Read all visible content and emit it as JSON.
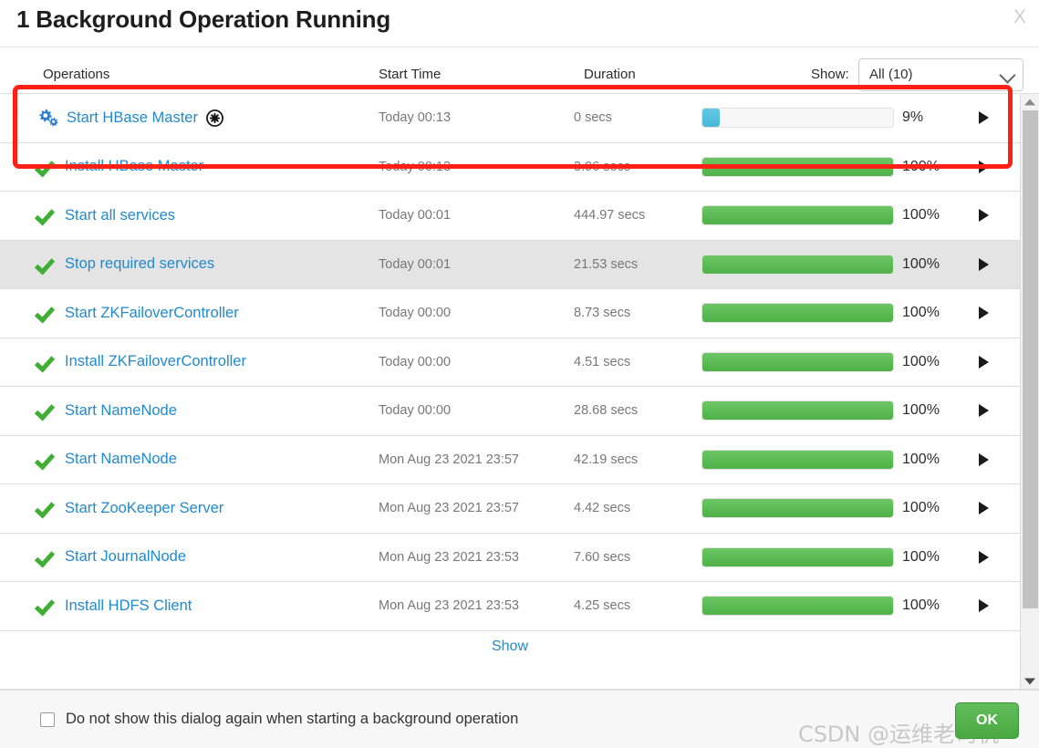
{
  "dialog": {
    "title": "1 Background Operation Running",
    "close_label": "X"
  },
  "columns": {
    "operations": "Operations",
    "start_time": "Start Time",
    "duration": "Duration",
    "show_label": "Show:",
    "show_selected": "All (10)",
    "show_options": [
      "All (10)"
    ]
  },
  "rows": [
    {
      "status_icon": "cogs-icon",
      "name": "Start HBase Master",
      "has_abort": true,
      "abort_icon": "abort-circle-icon",
      "start_time": "Today 00:13",
      "duration": "0 secs",
      "percent": 9,
      "percent_label": "9%",
      "state": "running",
      "highlight": false
    },
    {
      "status_icon": "check-icon",
      "name": "Install HBase Master",
      "has_abort": false,
      "start_time": "Today 00:13",
      "duration": "3.96 secs",
      "percent": 100,
      "percent_label": "100%",
      "state": "done",
      "highlight": false
    },
    {
      "status_icon": "check-icon",
      "name": "Start all services",
      "has_abort": false,
      "start_time": "Today 00:01",
      "duration": "444.97 secs",
      "percent": 100,
      "percent_label": "100%",
      "state": "done",
      "highlight": false
    },
    {
      "status_icon": "check-icon",
      "name": "Stop required services",
      "has_abort": false,
      "start_time": "Today 00:01",
      "duration": "21.53 secs",
      "percent": 100,
      "percent_label": "100%",
      "state": "done",
      "highlight": true
    },
    {
      "status_icon": "check-icon",
      "name": "Start ZKFailoverController",
      "has_abort": false,
      "start_time": "Today 00:00",
      "duration": "8.73 secs",
      "percent": 100,
      "percent_label": "100%",
      "state": "done",
      "highlight": false
    },
    {
      "status_icon": "check-icon",
      "name": "Install ZKFailoverController",
      "has_abort": false,
      "start_time": "Today 00:00",
      "duration": "4.51 secs",
      "percent": 100,
      "percent_label": "100%",
      "state": "done",
      "highlight": false
    },
    {
      "status_icon": "check-icon",
      "name": "Start NameNode",
      "has_abort": false,
      "start_time": "Today 00:00",
      "duration": "28.68 secs",
      "percent": 100,
      "percent_label": "100%",
      "state": "done",
      "highlight": false
    },
    {
      "status_icon": "check-icon",
      "name": "Start NameNode",
      "has_abort": false,
      "start_time": "Mon Aug 23 2021 23:57",
      "duration": "42.19 secs",
      "percent": 100,
      "percent_label": "100%",
      "state": "done",
      "highlight": false
    },
    {
      "status_icon": "check-icon",
      "name": "Start ZooKeeper Server",
      "has_abort": false,
      "start_time": "Mon Aug 23 2021 23:57",
      "duration": "4.42 secs",
      "percent": 100,
      "percent_label": "100%",
      "state": "done",
      "highlight": false
    },
    {
      "status_icon": "check-icon",
      "name": "Start JournalNode",
      "has_abort": false,
      "start_time": "Mon Aug 23 2021 23:53",
      "duration": "7.60 secs",
      "percent": 100,
      "percent_label": "100%",
      "state": "done",
      "highlight": false
    },
    {
      "status_icon": "check-icon",
      "name": "Install HDFS Client",
      "has_abort": false,
      "start_time": "Mon Aug 23 2021 23:53",
      "duration": "4.25 secs",
      "percent": 100,
      "percent_label": "100%",
      "state": "done",
      "highlight": false
    }
  ],
  "more_link": "Show",
  "footer": {
    "checkbox_label": "Do not show this dialog again when starting a background operation",
    "checkbox_checked": false,
    "ok_label": "OK",
    "watermark": "CSDN @运维老司机"
  },
  "scrollbar": {
    "up_icon": "scroll-up-arrow-icon",
    "down_icon": "scroll-down-arrow-icon"
  },
  "annotation": {
    "color": "#fc2114"
  },
  "colors": {
    "link": "#2289cf",
    "progress_done": "#4fb247",
    "progress_running": "#47b8d8",
    "ok_button": "#49a842",
    "row_highlight": "#e4e4e4"
  }
}
